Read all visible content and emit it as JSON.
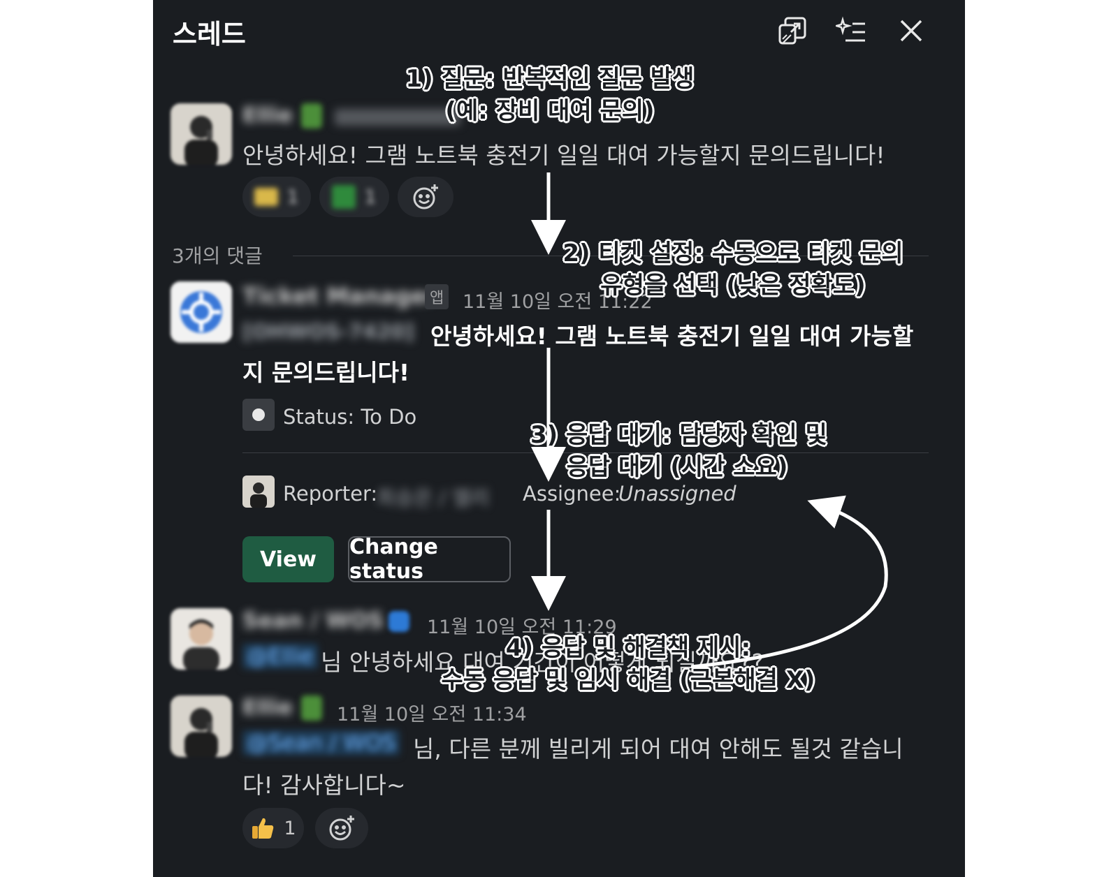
{
  "header": {
    "title": "스레드",
    "icons": [
      "open-in-window-icon",
      "ai-summary-icon",
      "close-icon"
    ]
  },
  "parent_message": {
    "text": "안녕하세요! 그램 노트북 충전기 일일 대여 가능할지 문의드립니다!",
    "author": "Ellie",
    "reaction_counts": [
      "1",
      "1"
    ]
  },
  "replies": {
    "count_label": "3개의 댓글"
  },
  "ticket_message": {
    "author": "Ticket Manager",
    "app_badge": "앱",
    "timestamp": "11월 10일 오전 11:22",
    "ticket_id": "[OHWOS-7420]",
    "text_line1": "안녕하세요! 그램 노트북 충전기 일일 대여 가능할",
    "text_line2": "지 문의드립니다!",
    "status": "Status: To Do",
    "reporter_label": "Reporter:",
    "reporter_value": "최승은 / 엘리",
    "assignee_label": "Assignee:",
    "assignee_value": "Unassigned",
    "view_button": "View",
    "change_status_button": "Change status"
  },
  "sean_message": {
    "author": "Sean / WOS",
    "timestamp": "11월 10일 오전 11:29",
    "mention": "@Ellie",
    "text": "님 안녕하세요 대여 기간이 어떻게 되실까요??"
  },
  "ellie_message": {
    "author": "Ellie",
    "timestamp": "11월 10일 오전 11:34",
    "mention": "@Sean / WOS",
    "text_line1": "님, 다른 분께 빌리게 되어 대여 안해도 될것 같습니",
    "text_line2": "다! 감사합니다~",
    "reaction_count": "1"
  },
  "annotations": {
    "a1_line1": "1) 질문: 반복적인 질문 발생",
    "a1_line2": "(예: 장비 대여 문의)",
    "a2_line1": "2) 티켓 설정: 수동으로 티켓 문의",
    "a2_line2": "유형을 선택 (낮은 정확도)",
    "a3_line1": "3) 응답 대기: 담당자 확인 및",
    "a3_line2": "응답 대기 (시간 소요)",
    "a4_line1": "4) 응답 및 해결책 제시:",
    "a4_line2": "수동 응답 및 임시 해결 (근본해결 X)"
  },
  "colors": {
    "panel_bg": "#1a1d21",
    "view_button": "#1f5c42",
    "mention_bg": "#1d3b56"
  }
}
